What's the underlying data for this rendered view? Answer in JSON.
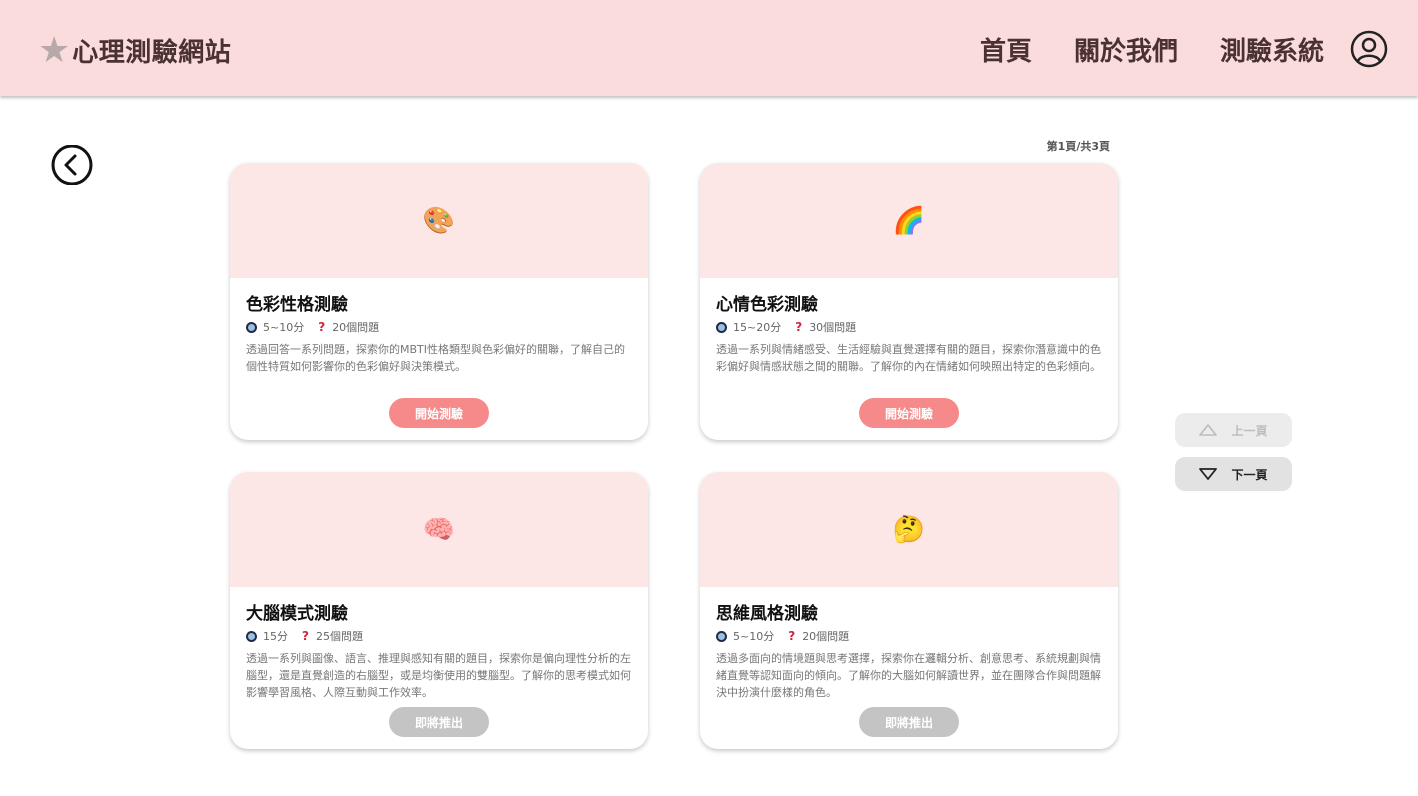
{
  "header": {
    "logo_star": "★",
    "logo_text": "心理測驗網站",
    "nav": [
      "首頁",
      "關於我們",
      "測驗系統"
    ]
  },
  "pagination": {
    "indicator": "第1頁/共3頁",
    "prev_label": "上一頁",
    "next_label": "下一頁"
  },
  "cards": [
    {
      "emoji": "🎨",
      "title": "色彩性格測驗",
      "time": "5~10分",
      "questions": "20個問題",
      "description": "透過回答一系列問題，探索你的MBTI性格類型與色彩偏好的關聯，了解自己的個性特質如何影響你的色彩偏好與決策模式。",
      "button": "開始測驗"
    },
    {
      "emoji": "🌈",
      "title": "心情色彩測驗",
      "time": "15~20分",
      "questions": "30個問題",
      "description": "透過一系列與情緒感受、生活經驗與直覺選擇有關的題目，探索你潛意識中的色彩偏好與情感狀態之間的關聯。了解你的內在情緒如何映照出特定的色彩傾向。",
      "button": "開始測驗"
    },
    {
      "emoji": "🧠",
      "title": "大腦模式測驗",
      "time": "15分",
      "questions": "25個問題",
      "description": "透過一系列與圖像、語言、推理與感知有關的題目，探索你是偏向理性分析的左腦型，還是直覺創造的右腦型，或是均衡使用的雙腦型。了解你的思考模式如何影響學習風格、人際互動與工作效率。",
      "button": "即將推出"
    },
    {
      "emoji": "🤔",
      "title": "思維風格測驗",
      "time": "5~10分",
      "questions": "20個問題",
      "description": "透過多面向的情境題與思考選擇，探索你在邏輯分析、創意思考、系統規劃與情緒直覺等認知面向的傾向。了解你的大腦如何解讀世界，並在團隊合作與問題解決中扮演什麼樣的角色。",
      "button": "即將推出"
    }
  ],
  "colors": {
    "header_bg": "#fbdcdc",
    "card_top_bg": "#fde6e6",
    "button_active": "#f68a8a",
    "button_disabled": "#c4c4c4"
  }
}
